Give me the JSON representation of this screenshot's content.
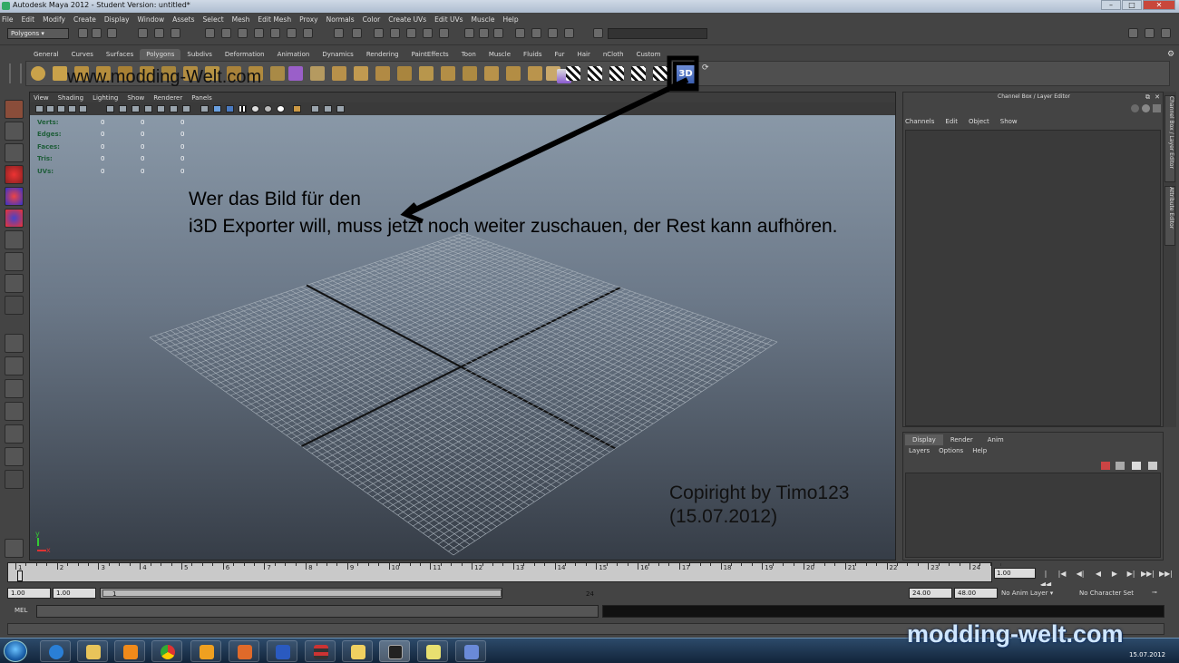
{
  "window": {
    "title": "Autodesk Maya 2012 - Student Version: untitled*",
    "min": "–",
    "max": "□",
    "close": "✕"
  },
  "menubar": [
    "File",
    "Edit",
    "Modify",
    "Create",
    "Display",
    "Window",
    "Assets",
    "Select",
    "Mesh",
    "Edit Mesh",
    "Proxy",
    "Normals",
    "Color",
    "Create UVs",
    "Edit UVs",
    "Muscle",
    "Help"
  ],
  "status_line": {
    "mode": "Polygons"
  },
  "shelf": {
    "tabs": [
      "General",
      "Curves",
      "Surfaces",
      "Polygons",
      "Subdivs",
      "Deformation",
      "Animation",
      "Dynamics",
      "Rendering",
      "PaintEffects",
      "Toon",
      "Muscle",
      "Fluids",
      "Fur",
      "Hair",
      "nCloth",
      "Custom"
    ],
    "active_tab": "Polygons",
    "highlight_icon_label": "3D"
  },
  "viewport": {
    "menu": [
      "View",
      "Shading",
      "Lighting",
      "Show",
      "Renderer",
      "Panels"
    ],
    "hud": [
      {
        "label": "Verts:",
        "values": [
          "0",
          "0",
          "0"
        ]
      },
      {
        "label": "Edges:",
        "values": [
          "0",
          "0",
          "0"
        ]
      },
      {
        "label": "Faces:",
        "values": [
          "0",
          "0",
          "0"
        ]
      },
      {
        "label": "Tris:",
        "values": [
          "0",
          "0",
          "0"
        ]
      },
      {
        "label": "UVs:",
        "values": [
          "0",
          "0",
          "0"
        ]
      }
    ],
    "axis_y": "y",
    "axis_x": "x"
  },
  "annotations": {
    "watermark": "www.modding-Welt.com",
    "caption_line1": "Wer das Bild für den",
    "caption_line2": "i3D Exporter will, muss jetzt noch weiter zuschauen, der Rest kann aufhören.",
    "copyright_line1": "Copiright by Timo123",
    "copyright_line2": "(15.07.2012)"
  },
  "channel_box": {
    "title": "Channel Box / Layer Editor",
    "menu": [
      "Channels",
      "Edit",
      "Object",
      "Show"
    ],
    "side_tabs": [
      "Channel Box / Layer Editor",
      "Attribute Editor"
    ]
  },
  "layer_editor": {
    "tabs": [
      "Display",
      "Render",
      "Anim"
    ],
    "active_tab": "Display",
    "menu": [
      "Layers",
      "Options",
      "Help"
    ]
  },
  "time_slider": {
    "ticks": [
      "1",
      "2",
      "3",
      "4",
      "5",
      "6",
      "7",
      "8",
      "9",
      "10",
      "11",
      "12",
      "13",
      "14",
      "15",
      "16",
      "17",
      "18",
      "19",
      "20",
      "21",
      "22",
      "23",
      "24"
    ],
    "current_frame": "1.00",
    "playback": [
      "|◀◀",
      "|◀",
      "◀|",
      "◀",
      "▶",
      "▶|",
      "▶▶|",
      "▶▶|"
    ]
  },
  "range_slider": {
    "start": "1.00",
    "playback_start": "1.00",
    "range_start_label": "1",
    "range_end_label": "24",
    "playback_end": "24.00",
    "end": "48.00",
    "anim_layer": "No Anim Layer",
    "character_set": "No Character Set"
  },
  "command_line": {
    "label": "MEL"
  },
  "taskbar": {
    "brand": "modding-welt.com",
    "date": "15.07.2012"
  }
}
